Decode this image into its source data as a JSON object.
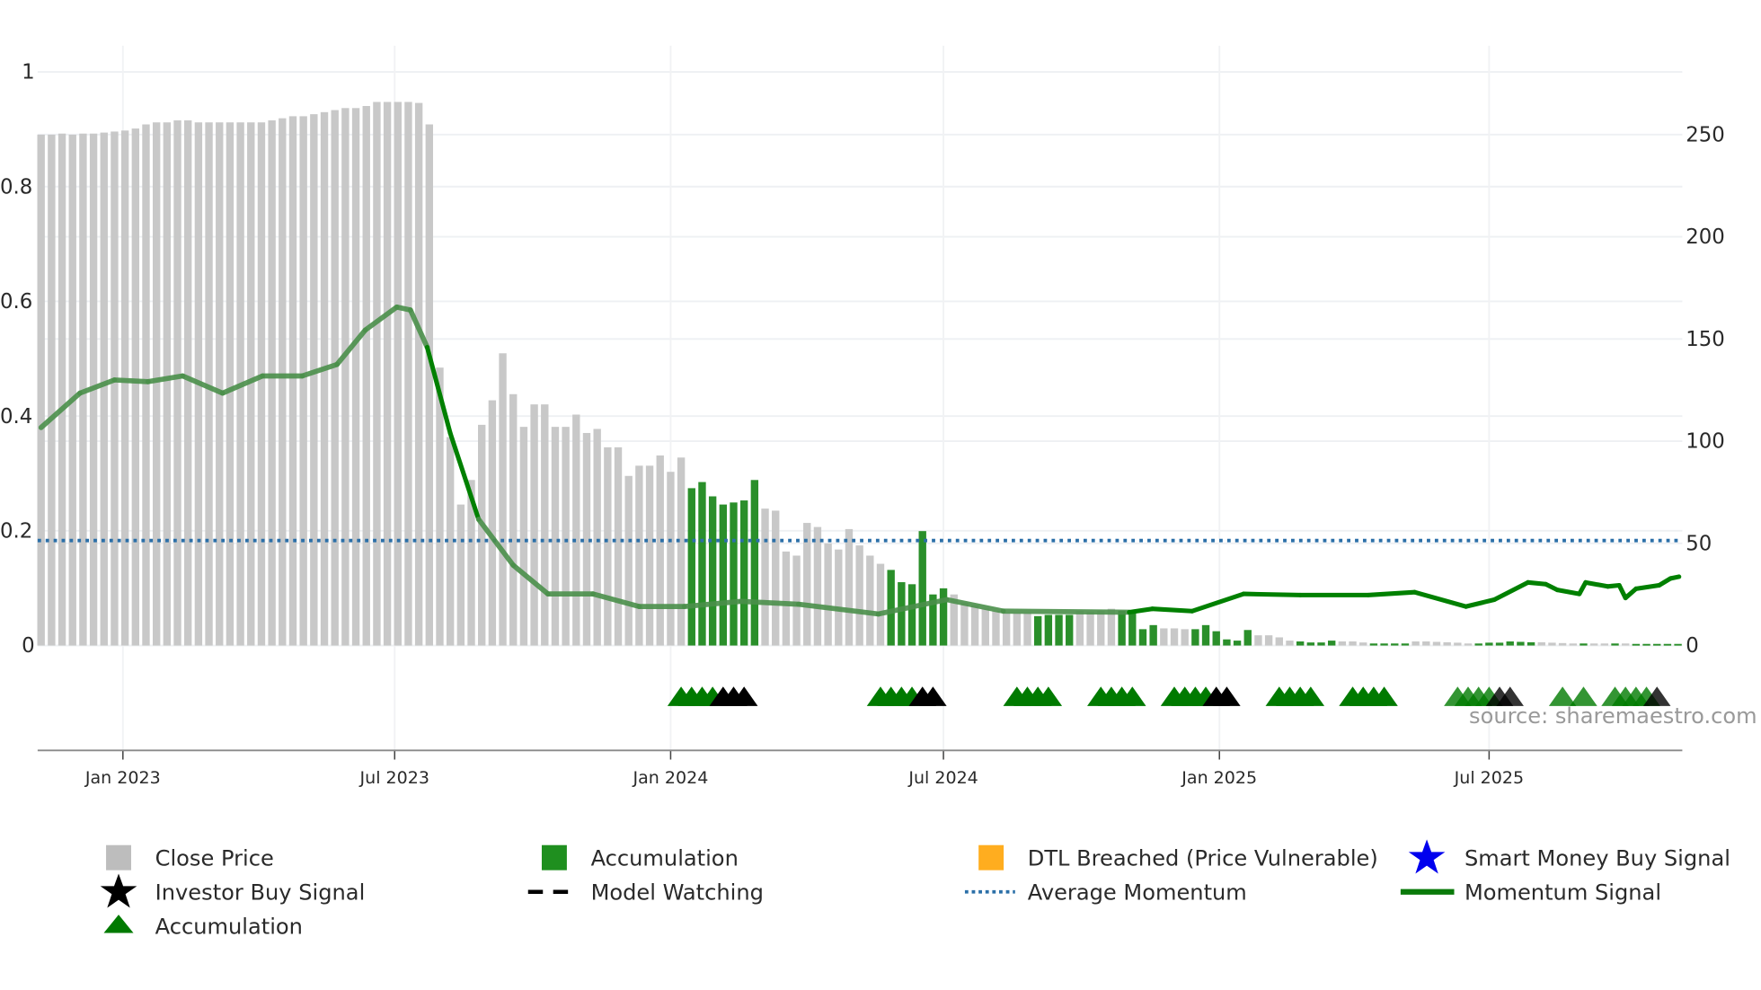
{
  "chart_data": {
    "type": "bar",
    "title": "",
    "x_unit": "week index (weekly bars)",
    "x_range": [
      -0.3,
      156.4
    ],
    "left_axis": {
      "ylim": [
        0,
        1
      ],
      "ticks": [
        0,
        0.2,
        0.4,
        0.6,
        0.8,
        1
      ],
      "tick_labels": [
        "0",
        "0.2",
        "0.4",
        "0.6",
        "0.8",
        "1"
      ]
    },
    "right_axis": {
      "ylim": [
        0,
        280.5
      ],
      "ticks": [
        0,
        50,
        100,
        150,
        200,
        250
      ],
      "tick_labels": [
        "0",
        "50",
        "100",
        "150",
        "200",
        "250"
      ]
    },
    "date_ticks": [
      {
        "label": "Jan 2023",
        "week": 7.8
      },
      {
        "label": "Jul 2023",
        "week": 33.7
      },
      {
        "label": "Jan 2024",
        "week": 60.0
      },
      {
        "label": "Jul 2024",
        "week": 86.0
      },
      {
        "label": "Jan 2025",
        "week": 112.3
      },
      {
        "label": "Jul 2025",
        "week": 138.0
      }
    ],
    "grid": true,
    "close_price": [
      250,
      250,
      250.5,
      250,
      250.5,
      250.5,
      251,
      251.5,
      252,
      253,
      255,
      256,
      256,
      257,
      257,
      256,
      256,
      256,
      256,
      256,
      256,
      256,
      257,
      258,
      259,
      259,
      260,
      261,
      262,
      263,
      263,
      264,
      266,
      266,
      266,
      266,
      265.5,
      255,
      136,
      102,
      69,
      81,
      108,
      120,
      143,
      123,
      107,
      118,
      118,
      107,
      107,
      113,
      104,
      106,
      97,
      97,
      83,
      88,
      88,
      93,
      85,
      92,
      77,
      80,
      73,
      69,
      70,
      71,
      81,
      67,
      66,
      46,
      44,
      60,
      58,
      50,
      47,
      57,
      49,
      44,
      40,
      37,
      31,
      30,
      56,
      25,
      28,
      25,
      21,
      19.6,
      18,
      17,
      16,
      16,
      16,
      14.4,
      15,
      15,
      15,
      17,
      16.5,
      17,
      18,
      17,
      17,
      8,
      10,
      8.4,
      8.4,
      8,
      8,
      10,
      7,
      3,
      2.4,
      7.6,
      5,
      5,
      4,
      2.4,
      2,
      1.5,
      1.5,
      2.4,
      2,
      2,
      1.5,
      1,
      1,
      1,
      1,
      2,
      2,
      1.8,
      1.6,
      1.4,
      1,
      1,
      1.4,
      1.4,
      2,
      1.8,
      1.6,
      1.6,
      1.4,
      1.2,
      1,
      1,
      1,
      1,
      1,
      1,
      0.8,
      0.8,
      0.8,
      0.8,
      0.8
    ],
    "accumulation_ranges": [
      [
        62,
        68
      ],
      [
        81,
        86
      ],
      [
        95,
        98
      ],
      [
        103,
        106
      ],
      [
        110,
        115
      ],
      [
        120,
        123
      ],
      [
        127,
        130
      ],
      [
        137,
        142
      ],
      [
        147,
        147
      ],
      [
        150,
        150
      ],
      [
        152,
        156
      ]
    ],
    "momentum_signal": [
      [
        0,
        0.38
      ],
      [
        3.7,
        0.44
      ],
      [
        7,
        0.463
      ],
      [
        10.2,
        0.46
      ],
      [
        13.5,
        0.47
      ],
      [
        17.3,
        0.44
      ],
      [
        21.1,
        0.47
      ],
      [
        24.9,
        0.47
      ],
      [
        28.2,
        0.49
      ],
      [
        30.9,
        0.55
      ],
      [
        33.9,
        0.59
      ],
      [
        35.2,
        0.585
      ],
      [
        36.8,
        0.52
      ],
      [
        39,
        0.37
      ],
      [
        41.7,
        0.22
      ],
      [
        45,
        0.14
      ],
      [
        48.3,
        0.09
      ],
      [
        52.6,
        0.09
      ],
      [
        57,
        0.068
      ],
      [
        61.3,
        0.068
      ],
      [
        66.7,
        0.077
      ],
      [
        72.2,
        0.072
      ],
      [
        79.8,
        0.055
      ],
      [
        86.3,
        0.08
      ],
      [
        91.7,
        0.06
      ],
      [
        103.7,
        0.058
      ],
      [
        105.9,
        0.064
      ],
      [
        109.7,
        0.06
      ],
      [
        114.6,
        0.09
      ],
      [
        120,
        0.088
      ],
      [
        126.5,
        0.088
      ],
      [
        130.9,
        0.093
      ],
      [
        135.8,
        0.068
      ],
      [
        138.5,
        0.08
      ],
      [
        141.7,
        0.11
      ],
      [
        143.4,
        0.107
      ],
      [
        144.5,
        0.097
      ],
      [
        146.6,
        0.09
      ],
      [
        147.2,
        0.11
      ],
      [
        149.3,
        0.103
      ],
      [
        150.4,
        0.105
      ],
      [
        151,
        0.083
      ],
      [
        152,
        0.099
      ],
      [
        154.2,
        0.105
      ],
      [
        155.3,
        0.117
      ],
      [
        156.1,
        0.12
      ]
    ],
    "momentum_solid_ranges": [
      [
        36.8,
        41.7
      ],
      [
        103.7,
        156.1
      ]
    ],
    "average_momentum": 0.183,
    "accumulation_markers": [
      61,
      62,
      63,
      64,
      80,
      81,
      82,
      83,
      93,
      94,
      95,
      96,
      101,
      102,
      103,
      104,
      108,
      109,
      110,
      111,
      118,
      119,
      120,
      121,
      125,
      126,
      127,
      128,
      135,
      136,
      137,
      138,
      145,
      147,
      150,
      151,
      152,
      153
    ],
    "investor_buy_markers": [
      65,
      66,
      67,
      84,
      85,
      112,
      113,
      139,
      140,
      154
    ],
    "faded_marker_from_week": 134,
    "colors": {
      "close": "#c8c8c8",
      "accumulation": "#2a8f2a",
      "momentum": "#008000",
      "average": "#2b6fa8",
      "triangle": "#007a00",
      "investor": "#000000",
      "dtl": "#ffad1f",
      "smart_money": "#0000ee"
    },
    "legend": {
      "placement": "bottom",
      "items": [
        {
          "label": "Close Price",
          "icon": "gray-square"
        },
        {
          "label": "Accumulation",
          "icon": "green-square"
        },
        {
          "label": "DTL Breached (Price Vulnerable)",
          "icon": "orange-square"
        },
        {
          "label": "Smart Money Buy Signal",
          "icon": "blue-star"
        },
        {
          "label": "Investor Buy Signal",
          "icon": "black-star"
        },
        {
          "label": "Model Watching",
          "icon": "black-dashed-line"
        },
        {
          "label": "Average Momentum",
          "icon": "blue-dotted-line"
        },
        {
          "label": "Momentum Signal",
          "icon": "green-line"
        },
        {
          "label": "Accumulation",
          "icon": "green-triangle"
        }
      ]
    },
    "source": "source: sharemaestro.com"
  }
}
